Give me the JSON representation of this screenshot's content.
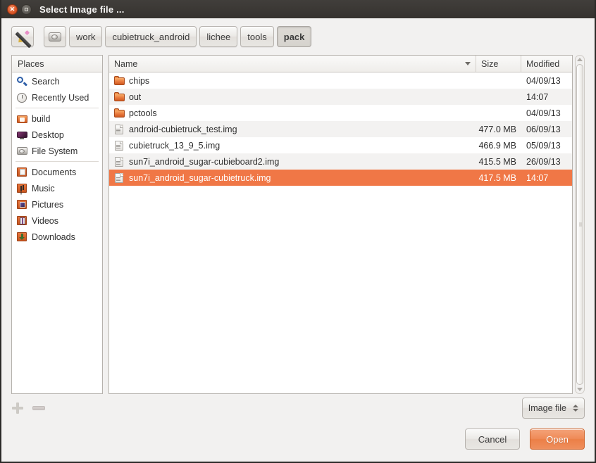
{
  "window": {
    "title": "Select Image file ...",
    "close_icon": "close-icon",
    "maximize_icon": "maximize-icon"
  },
  "toolbar": {
    "edit_button_icon": "pencil-icon",
    "device_button_icon": "hard-disk-icon",
    "path_buttons": [
      {
        "label": "work",
        "active": false
      },
      {
        "label": "cubietruck_android",
        "active": false
      },
      {
        "label": "lichee",
        "active": false
      },
      {
        "label": "tools",
        "active": false
      },
      {
        "label": "pack",
        "active": true
      }
    ]
  },
  "places": {
    "header": "Places",
    "items": [
      {
        "label": "Search",
        "icon": "search-icon",
        "kind": "search"
      },
      {
        "label": "Recently Used",
        "icon": "clock-icon",
        "kind": "recent"
      },
      {
        "separator": true
      },
      {
        "label": "build",
        "icon": "home-folder-icon",
        "kind": "home"
      },
      {
        "label": "Desktop",
        "icon": "desktop-icon",
        "kind": "desktop"
      },
      {
        "label": "File System",
        "icon": "hard-disk-icon",
        "kind": "disk"
      },
      {
        "separator": true
      },
      {
        "label": "Documents",
        "icon": "documents-folder-icon",
        "kind": "doc"
      },
      {
        "label": "Music",
        "icon": "music-folder-icon",
        "kind": "music"
      },
      {
        "label": "Pictures",
        "icon": "pictures-folder-icon",
        "kind": "pictures"
      },
      {
        "label": "Videos",
        "icon": "videos-folder-icon",
        "kind": "videos"
      },
      {
        "label": "Downloads",
        "icon": "downloads-folder-icon",
        "kind": "downloads"
      }
    ],
    "add_button_icon": "plus-icon",
    "remove_button_icon": "minus-icon"
  },
  "file_list": {
    "columns": [
      "Name",
      "Size",
      "Modified"
    ],
    "sort_column": "Name",
    "sort_direction": "descending",
    "rows": [
      {
        "name": "chips",
        "size": "",
        "modified": "04/09/13",
        "type": "folder",
        "selected": false
      },
      {
        "name": "out",
        "size": "",
        "modified": "14:07",
        "type": "folder",
        "selected": false
      },
      {
        "name": "pctools",
        "size": "",
        "modified": "04/09/13",
        "type": "folder",
        "selected": false
      },
      {
        "name": "android-cubietruck_test.img",
        "size": "477.0 MB",
        "modified": "06/09/13",
        "type": "file",
        "selected": false
      },
      {
        "name": "cubietruck_13_9_5.img",
        "size": "466.9 MB",
        "modified": "05/09/13",
        "type": "file",
        "selected": false
      },
      {
        "name": "sun7i_android_sugar-cubieboard2.img",
        "size": "415.5 MB",
        "modified": "26/09/13",
        "type": "file",
        "selected": false
      },
      {
        "name": "sun7i_android_sugar-cubietruck.img",
        "size": "417.5 MB",
        "modified": "14:07",
        "type": "file",
        "selected": true
      }
    ]
  },
  "filter": {
    "selected_option": "Image file"
  },
  "actions": {
    "cancel_label": "Cancel",
    "open_label": "Open"
  },
  "colors": {
    "selection": "#f07746",
    "titlebar": "#393632",
    "window_bg": "#f2f1f0",
    "primary_button": "#ec7f47"
  }
}
